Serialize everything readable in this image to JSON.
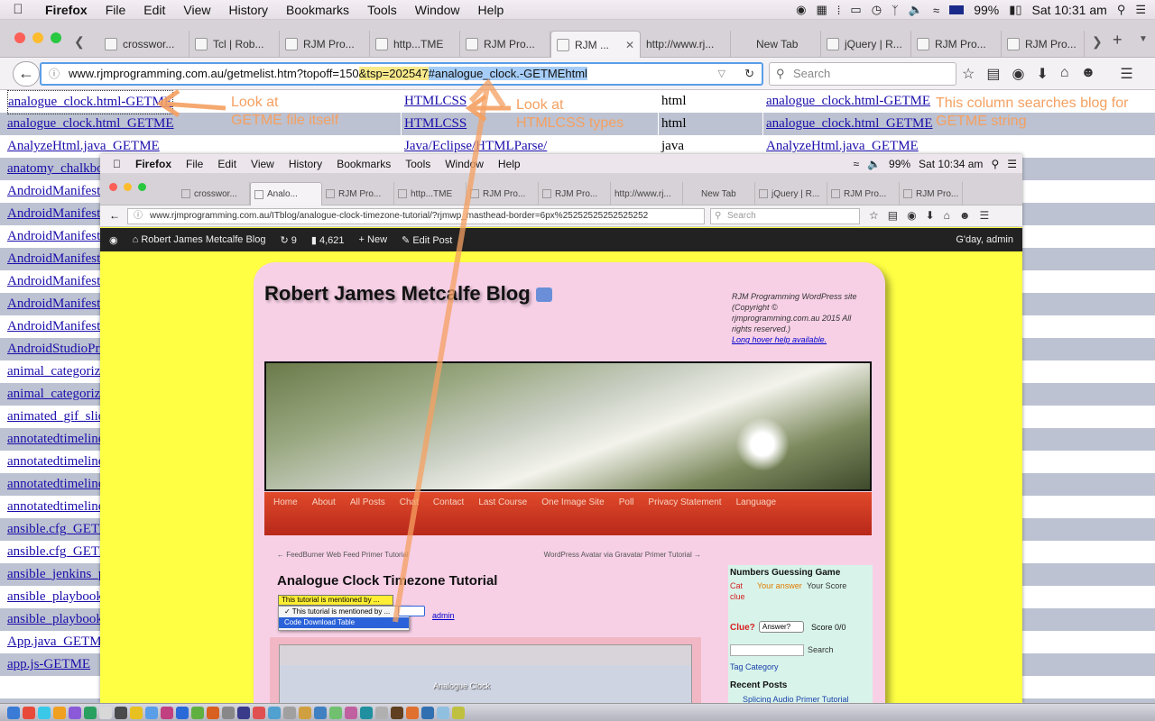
{
  "menubar": {
    "items": [
      "Firefox",
      "File",
      "Edit",
      "View",
      "History",
      "Bookmarks",
      "Tools",
      "Window",
      "Help"
    ],
    "battery": "99%",
    "clock": "Sat 10:31 am"
  },
  "tabs": [
    "crosswor...",
    "Tcl | Rob...",
    "RJM Pro...",
    "http...TME",
    "RJM Pro...",
    "RJM ...",
    "http://www.rj...",
    "New Tab",
    "jQuery | R...",
    "RJM Pro...",
    "RJM Pro..."
  ],
  "active_tab": 5,
  "url": {
    "part1": "www.rjmprogramming.com.au/getmelist.htm?topoff=150",
    "part2": "&tsp=202547",
    "part3": "#analogue_clock.-GETMEhtml"
  },
  "search_placeholder": "Search",
  "table_rows": [
    {
      "c1": "analogue_clock.html-GETME",
      "c2": "HTMLCSS",
      "c3": "html",
      "c4": "analogue_clock.html-GETME"
    },
    {
      "c1": "analogue_clock.html_GETME",
      "c2": "HTMLCSS",
      "c3": "html",
      "c4": "analogue_clock.html_GETME"
    },
    {
      "c1": "AnalyzeHtml.java_GETME",
      "c2": "Java/Eclipse/HTMLParse/",
      "c3": "java",
      "c4": "AnalyzeHtml.java_GETME"
    },
    {
      "c1": "anatomy_chalkboa"
    },
    {
      "c1": "AndroidManifest.x"
    },
    {
      "c1": "AndroidManifest.x"
    },
    {
      "c1": "AndroidManifest.x"
    },
    {
      "c1": "AndroidManifest.x"
    },
    {
      "c1": "AndroidManifest.x"
    },
    {
      "c1": "AndroidManifest.x"
    },
    {
      "c1": "AndroidManifest.x"
    },
    {
      "c1": "AndroidStudioPri"
    },
    {
      "c1": "animal_categoriz"
    },
    {
      "c1": "animal_categoriz"
    },
    {
      "c1": "animated_gif_slid"
    },
    {
      "c1": "annotatedtimeline"
    },
    {
      "c1": "annotatedtimeline"
    },
    {
      "c1": "annotatedtimeline"
    },
    {
      "c1": "annotatedtimeline"
    },
    {
      "c1": "ansible.cfg_GETM"
    },
    {
      "c1": "ansible.cfg_GETM"
    },
    {
      "c1": "ansible_jenkins_p"
    },
    {
      "c1": "ansible_playbook."
    },
    {
      "c1": "ansible_playbook."
    },
    {
      "c1": "App.java_GETME"
    },
    {
      "c1": "app.js-GETME"
    }
  ],
  "notes": {
    "n1": "Look at\nGETME file itself",
    "n2": "Look at\nHTMLCSS types",
    "n3": "This column searches blog for\nGETME string"
  },
  "inset": {
    "clock": "Sat 10:34 am",
    "battery": "99%",
    "tabs": [
      "crosswor...",
      "Analo...",
      "RJM Pro...",
      "http...TME",
      "RJM Pro...",
      "RJM Pro...",
      "http://www.rj...",
      "New Tab",
      "jQuery | R...",
      "RJM Pro...",
      "RJM Pro..."
    ],
    "url": "www.rjmprogramming.com.au/ITblog/analogue-clock-timezone-tutorial/?rjmwp_masthead-border=6px%25252525252525252",
    "search": "Search",
    "admin_bar": {
      "site": "Robert James Metcalfe Blog",
      "updates": "9",
      "comments": "4,621",
      "new": "New",
      "edit": "Edit Post",
      "greet": "G'day, admin"
    },
    "blog_title": "Robert James Metcalfe Blog",
    "side_text": "RJM Programming WordPress site (Copyright © rjmprogramming.com.au 2015 All rights reserved.)",
    "side_link": "Long hover help available.",
    "nav": [
      "Home",
      "About",
      "All Posts",
      "Chat",
      "Contact",
      "Last Course",
      "One Image Site",
      "Poll",
      "Privacy Statement",
      "Language"
    ],
    "prev_post": "← FeedBurner Web Feed Primer Tutorial",
    "next_post": "WordPress Avatar via Gravatar Primer Tutorial →",
    "post_title": "Analogue Clock Timezone Tutorial",
    "dropdown_value": "This tutorial is mentioned by ...",
    "dropdown_options": [
      "This tutorial is mentioned by ...",
      "Code Download Table"
    ],
    "admin_link": "admin",
    "shot_caption": "Analogue Clock",
    "widget": {
      "title": "Numbers Guessing Game",
      "h_col1": "Cat clue",
      "h_col2": "Your answer",
      "h_col3": "Your Score",
      "clue": "Clue?",
      "answer": "Answer?",
      "score": "Score 0/0",
      "search_label": "Search",
      "radios": "Tag   Category",
      "recent": "Recent Posts",
      "recent_item": "Splicing Audio Primer Tutorial"
    }
  },
  "colors": {
    "note": "#f5a061",
    "highlight": "#f7e98a",
    "inset_bg": "#ffff44",
    "blog_panel": "#f7d0e6"
  }
}
